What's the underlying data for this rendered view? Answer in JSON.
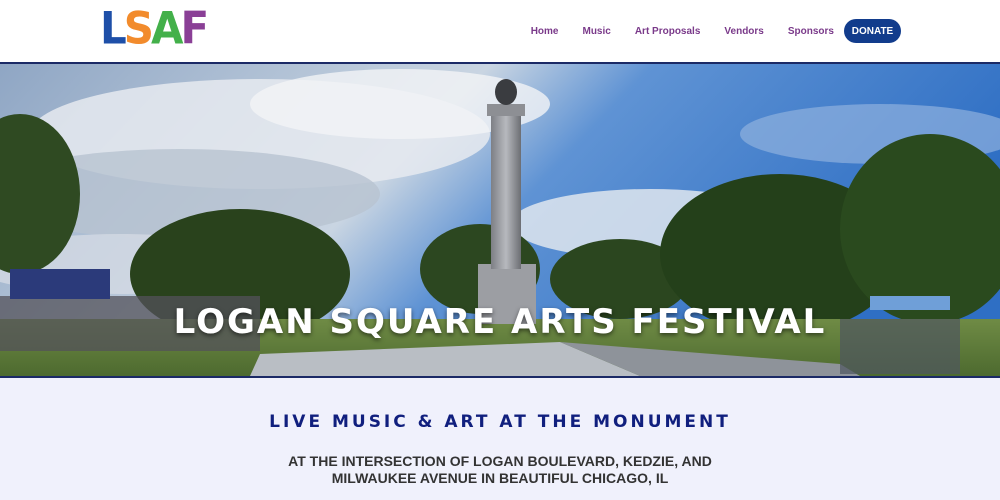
{
  "header": {
    "logo": {
      "letters": [
        "L",
        "S",
        "A",
        "F"
      ],
      "colors": [
        "#1e4fa8",
        "#f28b2c",
        "#43b04a",
        "#8a3f96"
      ]
    },
    "nav": {
      "home": "Home",
      "music": "Music",
      "art_proposals": "Art Proposals",
      "vendors": "Vendors",
      "sponsors": "Sponsors",
      "donate": "DONATE"
    },
    "accent": "#123c8c",
    "nav_color": "#7a3a8a"
  },
  "hero": {
    "title": "LOGAN SQUARE ARTS FESTIVAL"
  },
  "main": {
    "tagline": "LIVE MUSIC & ART AT THE MONUMENT",
    "address": "AT THE INTERSECTION OF LOGAN BOULEVARD, KEDZIE, AND MILWAUKEE AVENUE IN BEAUTIFUL CHICAGO, IL",
    "tagline_color": "#101f7e"
  }
}
